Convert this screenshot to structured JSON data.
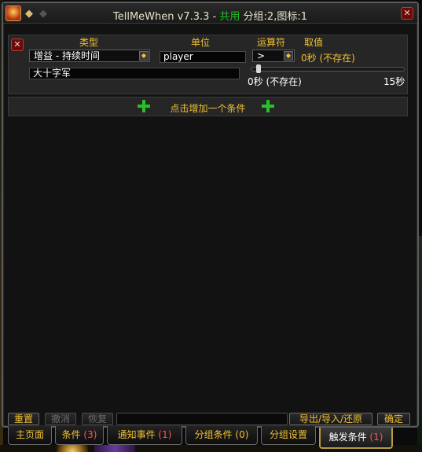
{
  "window": {
    "title_app": "TellMeWhen v7.3.3",
    "title_sep": " - ",
    "title_shared": "共用",
    "title_group": " 分组:2",
    "title_comma": ",",
    "title_icon": "图标:1",
    "back_icon": "arrow-left-icon",
    "forward_icon": "arrow-right-icon"
  },
  "condition": {
    "headers": {
      "type": "类型",
      "unit": "单位",
      "operator": "运算符",
      "value": "取值"
    },
    "type_value": "增益 - 持续时间",
    "unit_value": "player",
    "operator_value": ">",
    "value_display": "0秒 (不存在)",
    "name_value": "大十字军",
    "slider": {
      "min_label": "0秒 (不存在)",
      "max_label": "15秒",
      "value": 0
    }
  },
  "add_condition": {
    "label": "点击增加一个条件"
  },
  "buttons": {
    "reset": "重置",
    "undo": "撤消",
    "redo": "恢复",
    "export": "导出/导入/还原",
    "ok": "确定"
  },
  "tabs": [
    {
      "label": "主页面",
      "count": ""
    },
    {
      "label": "条件",
      "count": "(3)"
    },
    {
      "label": "通知事件",
      "count": "(1)"
    },
    {
      "label": "分组条件",
      "count": "(0)"
    },
    {
      "label": "分组设置",
      "count": ""
    },
    {
      "label": "触发条件",
      "count": "(1)"
    }
  ],
  "colors": {
    "accent_gold": "#f0c030",
    "shared_green": "#20c020",
    "count_red": "#ff5050",
    "plus_green": "#28c028"
  }
}
